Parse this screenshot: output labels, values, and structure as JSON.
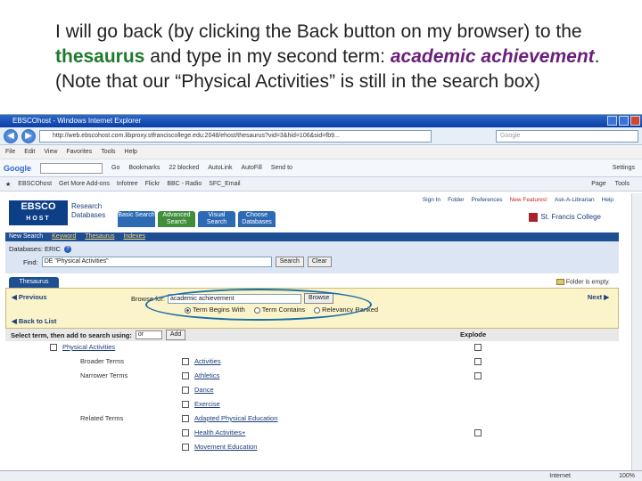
{
  "caption": {
    "part1": "I will go back (by clicking the Back button on my browser) to the ",
    "thesaurus": "thesaurus",
    "part2": " and type in my second term: ",
    "term": "academic achievement",
    "part3": ". (Note that our “Physical Activities” is still in the search box)"
  },
  "browser": {
    "title": "EBSCOhost - Windows Internet Explorer",
    "url": "http://web.ebscohost.com.libproxy.stfranciscollege.edu:2048/ehost/thesaurus?vid=3&hid=106&sid=fb9...",
    "search_placeholder": "Google",
    "menu": [
      "File",
      "Edit",
      "View",
      "Favorites",
      "Tools",
      "Help"
    ],
    "google_bar": {
      "logo": "Google",
      "go": "Go",
      "items": [
        "Bookmarks",
        "22 blocked",
        "AutoLink",
        "AutoFill",
        "Send to",
        "Settings"
      ]
    },
    "favorites": {
      "tab": "EBSCOhost",
      "links": [
        "Get More Add-ons",
        "Infotree",
        "Flickr",
        "BBC - Radio",
        "SFC_Email"
      ],
      "right": [
        "Page",
        "Tools"
      ]
    },
    "status": {
      "zone": "Internet",
      "zoom": "100%"
    }
  },
  "ebsco": {
    "logo_top": "EBSCO",
    "logo_bottom": "HOST",
    "research_label": "Research Databases",
    "tabs": [
      "Basic Search",
      "Advanced Search",
      "Visual Search",
      "Choose Databases"
    ],
    "top_links": [
      "Sign In",
      "Folder",
      "Preferences",
      "New Features!",
      "Ask-A-Librarian",
      "Help"
    ],
    "college": "St. Francis College",
    "subnav": [
      "New Search",
      "Keyword",
      "Thesaurus",
      "Indexes"
    ],
    "databases_label": "Databases: ERIC",
    "find_label": "Find:",
    "find_value": "DE \"Physical Activities\"",
    "search_btn": "Search",
    "clear_btn": "Clear",
    "thesaurus_tab": "Thesaurus",
    "folder_status": "Folder is empty.",
    "previous": "Previous",
    "next": "Next",
    "browse_for_label": "Browse for:",
    "browse_value": "academic achievement",
    "browse_btn": "Browse",
    "radio_options": [
      "Term Begins With",
      "Term Contains",
      "Relevancy Ranked"
    ],
    "back_to_list": "Back to List",
    "select_label": "Select term, then add to search using:",
    "select_value": "or",
    "add_btn": "Add",
    "explode_label": "Explode",
    "tree": [
      {
        "label": "",
        "term": "Physical Activities",
        "explode": true,
        "indent": "top"
      },
      {
        "label": "Broader Terms",
        "term": "Activities",
        "explode": true
      },
      {
        "label": "Narrower Terms",
        "term": "Athletics",
        "explode": true
      },
      {
        "label": "",
        "term": "Dance",
        "explode": false
      },
      {
        "label": "",
        "term": "Exercise",
        "explode": false
      },
      {
        "label": "Related Terms",
        "term": "Adapted Physical Education",
        "explode": false
      },
      {
        "label": "",
        "term": "Health Activities+",
        "explode": true
      },
      {
        "label": "",
        "term": "Movement Education",
        "explode": false
      }
    ]
  }
}
